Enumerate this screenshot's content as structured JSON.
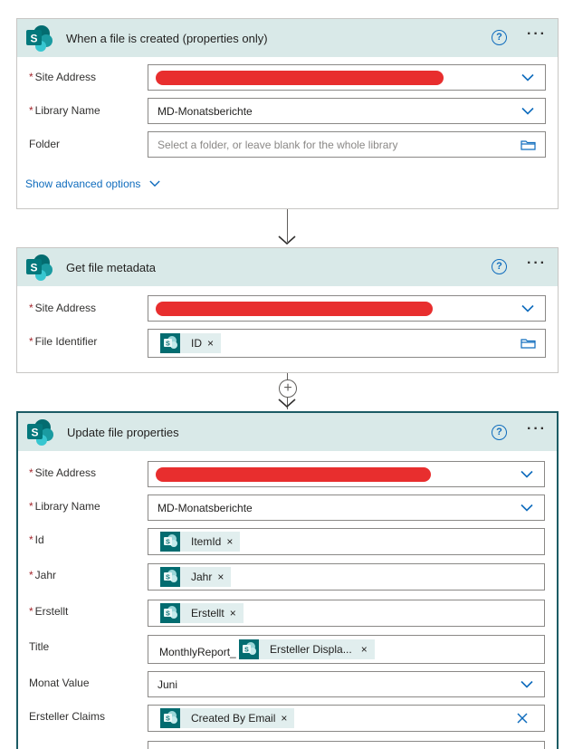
{
  "cards": {
    "trigger": {
      "title": "When a file is created (properties only)",
      "fields": {
        "site_label": "Site Address",
        "library_label": "Library Name",
        "library_value": "MD-Monatsberichte",
        "folder_label": "Folder",
        "folder_placeholder": "Select a folder, or leave blank for the whole library"
      },
      "advanced": "Show advanced options"
    },
    "metadata": {
      "title": "Get file metadata",
      "fields": {
        "site_label": "Site Address",
        "file_id_label": "File Identifier",
        "file_id_token": "ID"
      }
    },
    "update": {
      "title": "Update file properties",
      "fields": {
        "site_label": "Site Address",
        "library_label": "Library Name",
        "library_value": "MD-Monatsberichte",
        "id_label": "Id",
        "id_token": "ItemId",
        "jahr_label": "Jahr",
        "jahr_token": "Jahr",
        "erstellt_label": "Erstellt",
        "erstellt_token": "Erstellt",
        "title_label": "Title",
        "title_prefix": "MonthlyReport_",
        "title_token": "Ersteller Displa...",
        "monat_label": "Monat Value",
        "monat_value": "Juni",
        "claims_label": "Ersteller Claims",
        "claims_token": "Created By Email"
      }
    }
  },
  "required_mark": "*",
  "token_remove": "×",
  "help_glyph": "?",
  "more_glyph": "···",
  "plus_glyph": "+",
  "icons": {
    "connector": "sharepoint-logo",
    "dropdown": "chevron-down-icon",
    "folder": "folder-icon",
    "help": "help-icon",
    "more": "more-icon"
  },
  "colors": {
    "header_bg": "#d9e9e8",
    "brand": "#036c70",
    "link": "#0f6cbd",
    "required": "#a4262c",
    "redaction": "#e61c1c"
  }
}
